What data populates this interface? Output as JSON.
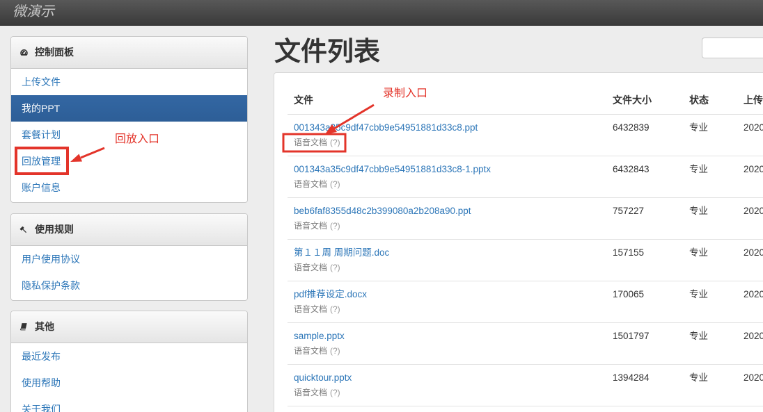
{
  "app": {
    "logo": "微演示"
  },
  "theme": {
    "link": "#2c76b8",
    "active_bg": "#2d5e97",
    "annotation": "#e3342a"
  },
  "sidebar": {
    "panels": [
      {
        "title": "控制面板",
        "icon": "dashboard-icon",
        "items": [
          {
            "label": "上传文件"
          },
          {
            "label": "我的PPT",
            "active": true
          },
          {
            "label": "套餐计划"
          },
          {
            "label": "回放管理"
          },
          {
            "label": "账户信息"
          }
        ]
      },
      {
        "title": "使用规则",
        "icon": "gavel-icon",
        "items": [
          {
            "label": "用户使用协议"
          },
          {
            "label": "隐私保护条款"
          }
        ]
      },
      {
        "title": "其他",
        "icon": "book-icon",
        "items": [
          {
            "label": "最近发布"
          },
          {
            "label": "使用帮助"
          },
          {
            "label": "关于我们"
          }
        ]
      }
    ]
  },
  "main": {
    "title": "文件列表",
    "table": {
      "columns": [
        "文件",
        "文件大小",
        "状态",
        "上传"
      ],
      "rows": [
        {
          "name": "001343a35c9df47cbb9e54951881d33c8.ppt",
          "kind": "语音文档",
          "help": "(?)",
          "size": 6432839,
          "status": "专业",
          "uploaded": "2020"
        },
        {
          "name": "001343a35c9df47cbb9e54951881d33c8-1.pptx",
          "kind": "语音文档",
          "help": "(?)",
          "size": 6432843,
          "status": "专业",
          "uploaded": "2020"
        },
        {
          "name": "beb6faf8355d48c2b399080a2b208a90.ppt",
          "kind": "语音文档",
          "help": "(?)",
          "size": 757227,
          "status": "专业",
          "uploaded": "2020"
        },
        {
          "name": "第１１周 周期问题.doc",
          "kind": "语音文档",
          "help": "(?)",
          "size": 157155,
          "status": "专业",
          "uploaded": "2020"
        },
        {
          "name": "pdf推荐设定.docx",
          "kind": "语音文档",
          "help": "(?)",
          "size": 170065,
          "status": "专业",
          "uploaded": "2020"
        },
        {
          "name": "sample.pptx",
          "kind": "语音文档",
          "help": "(?)",
          "size": 1501797,
          "status": "专业",
          "uploaded": "2020"
        },
        {
          "name": "quicktour.pptx",
          "kind": "语音文档",
          "help": "(?)",
          "size": 1394284,
          "status": "专业",
          "uploaded": "2020"
        }
      ]
    }
  },
  "annotations": {
    "record_entry": "录制入口",
    "playback_entry": "回放入口"
  }
}
